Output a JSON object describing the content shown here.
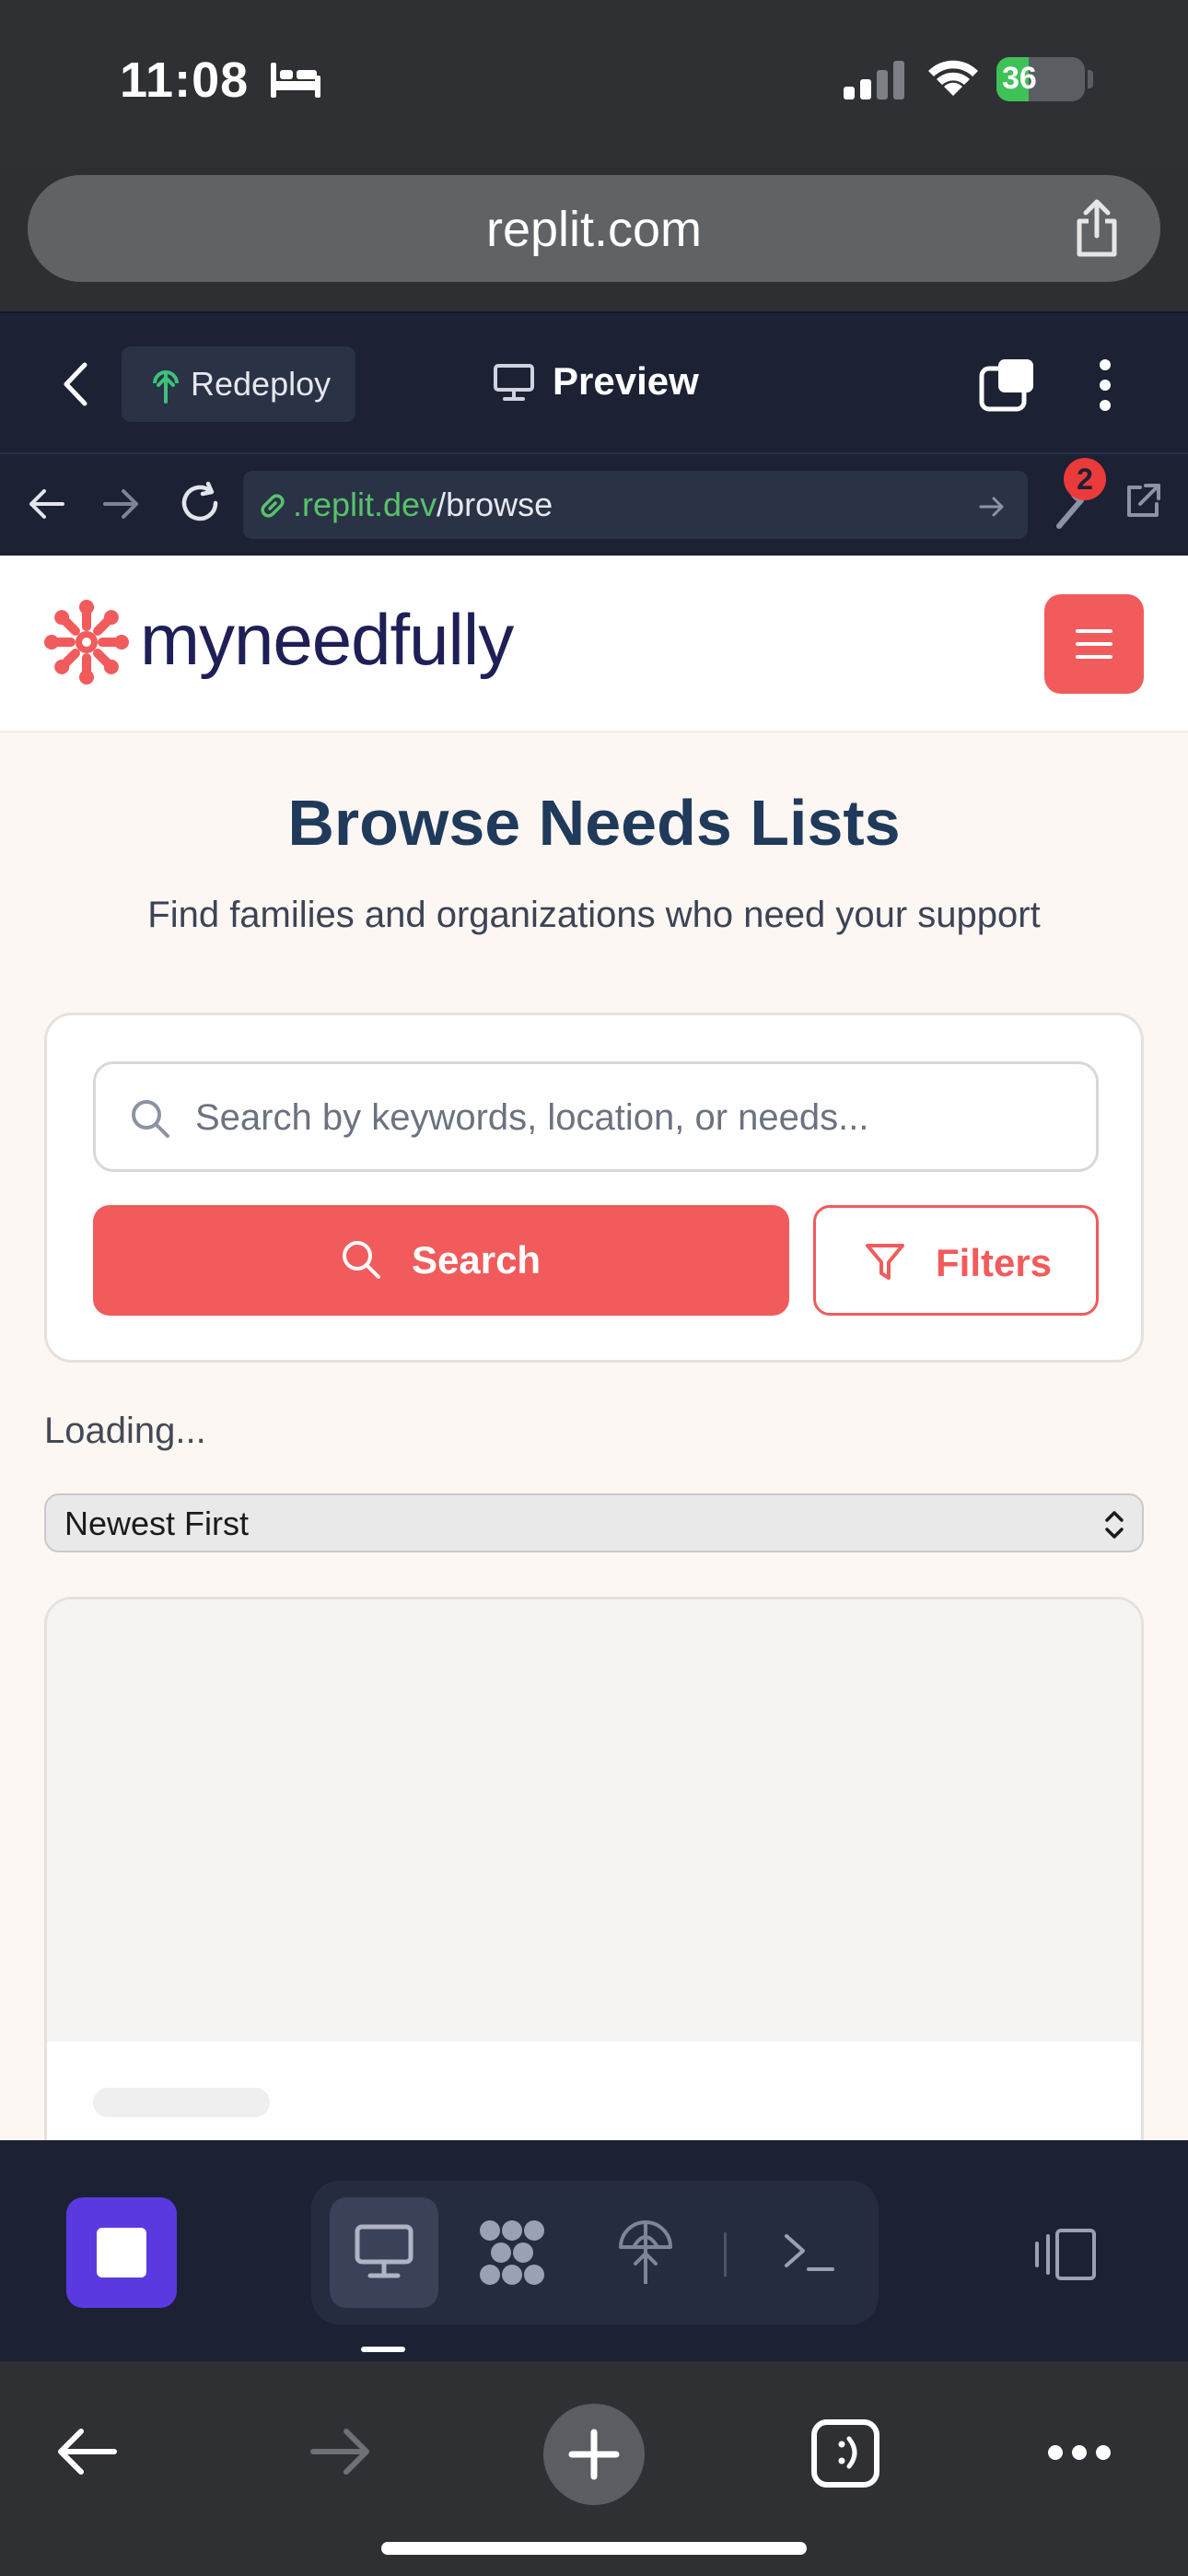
{
  "status_bar": {
    "time": "11:08",
    "battery_percent": "36"
  },
  "safari": {
    "url": "replit.com"
  },
  "replit": {
    "redeploy_label": "Redeploy",
    "preview_label": "Preview",
    "notification_count": "2",
    "address": {
      "domain": ".replit.dev",
      "path": "/browse"
    }
  },
  "site": {
    "brand": "myneedfully",
    "brand_color": "#1f1f57",
    "accent_color": "#f15b5b"
  },
  "page": {
    "title": "Browse Needs Lists",
    "subtitle": "Find families and organizations who need your support",
    "search_placeholder": "Search by keywords, location, or needs...",
    "search_button": "Search",
    "filters_button": "Filters",
    "loading_text": "Loading...",
    "sort_selected": "Newest First"
  },
  "icons": {
    "status": [
      "bed-icon",
      "signal-icon",
      "wifi-icon",
      "battery-icon"
    ],
    "dock": [
      "stop-icon",
      "monitor-icon",
      "apps-icon",
      "deploy-icon",
      "terminal-icon",
      "panel-icon"
    ],
    "toolbar": [
      "back-arrow-icon",
      "forward-arrow-icon",
      "new-tab-plus-icon",
      "tabs-icon",
      "more-icon"
    ]
  }
}
